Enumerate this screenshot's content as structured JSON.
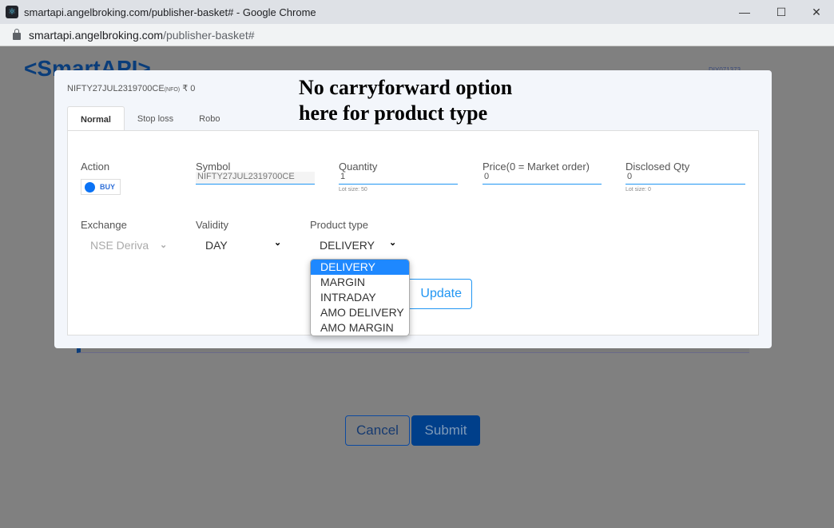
{
  "window": {
    "title": "smartapi.angelbroking.com/publisher-basket# - Google Chrome",
    "url_host": "smartapi.angelbroking.com",
    "url_path": "/publisher-basket#"
  },
  "page": {
    "logo_prefix": "<Smart",
    "logo_suffix": "API>",
    "user_id": "DIY071373",
    "cancel": "Cancel",
    "submit": "Submit"
  },
  "modal": {
    "symbol_title": "NIFTY27JUL2319700CE",
    "exchange_tag": "(NFO)",
    "price_tag": "₹ 0",
    "note_line1": "No carryforward option",
    "note_line2": "here for product type",
    "tabs": [
      {
        "label": "Normal",
        "active": true
      },
      {
        "label": "Stop loss"
      },
      {
        "label": "Robo"
      }
    ],
    "action": {
      "label": "Action",
      "value": "BUY"
    },
    "symbol": {
      "label": "Symbol",
      "value": "NIFTY27JUL2319700CE"
    },
    "quantity": {
      "label": "Quantity",
      "value": "1",
      "hint": "Lot size: 50"
    },
    "price": {
      "label": "Price(0 = Market order)",
      "value": "0"
    },
    "disclosed": {
      "label": "Disclosed Qty",
      "value": "0",
      "hint": "Lot size: 0"
    },
    "exchange": {
      "label": "Exchange",
      "value": "NSE Deriva"
    },
    "validity": {
      "label": "Validity",
      "value": "DAY"
    },
    "product_type": {
      "label": "Product type",
      "value": "DELIVERY",
      "options": [
        "DELIVERY",
        "MARGIN",
        "INTRADAY",
        "AMO DELIVERY",
        "AMO MARGIN"
      ]
    },
    "update": "Update"
  },
  "colors": {
    "accent": "#2196f3",
    "brand": "#003f8a",
    "selected": "#1e88ff"
  }
}
